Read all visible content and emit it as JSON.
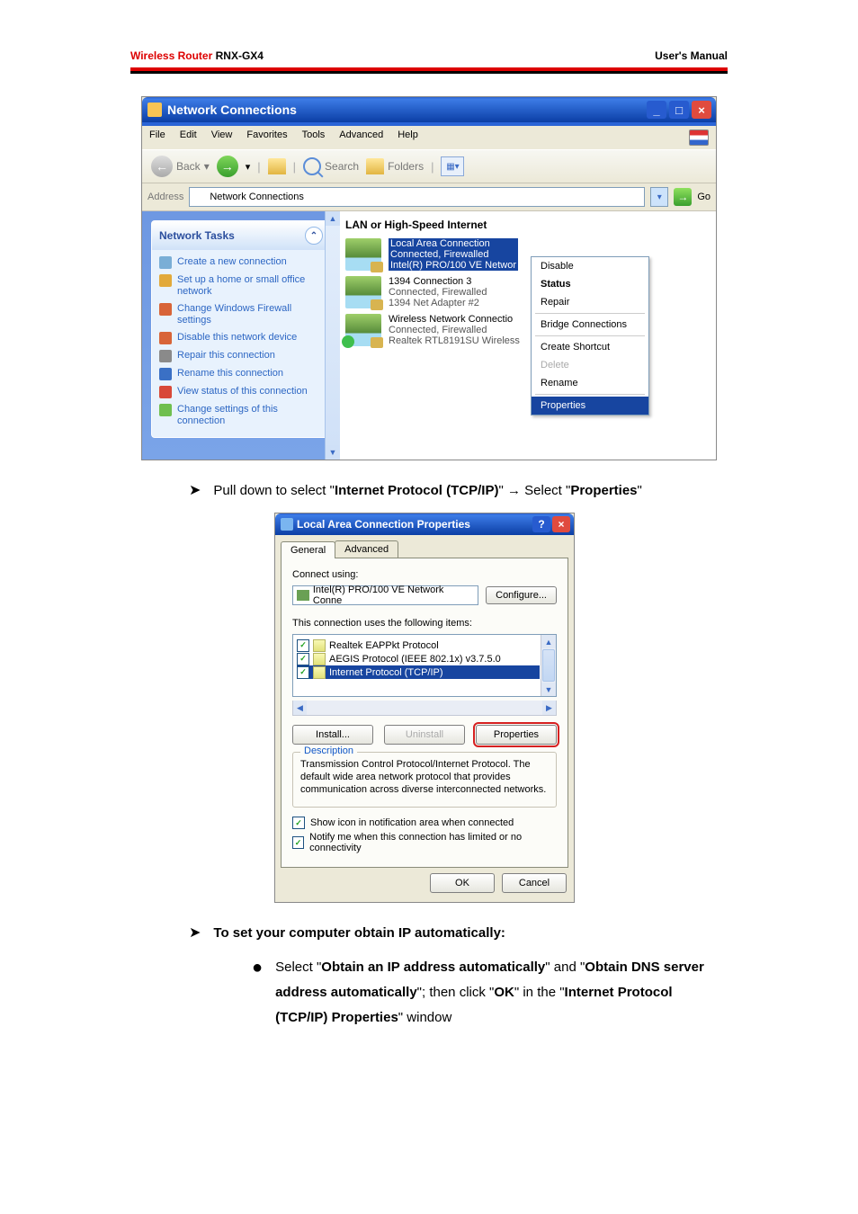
{
  "header": {
    "brand_red": "Wireless Router",
    "model": "RNX-GX4",
    "manual": "User's Manual"
  },
  "win1": {
    "title": "Network Connections",
    "menus": [
      "File",
      "Edit",
      "View",
      "Favorites",
      "Tools",
      "Advanced",
      "Help"
    ],
    "toolbar": {
      "back": "Back",
      "search": "Search",
      "folders": "Folders"
    },
    "address": {
      "label": "Address",
      "value": "Network Connections",
      "go": "Go"
    },
    "tasks_title": "Network Tasks",
    "tasks": [
      "Create a new connection",
      "Set up a home or small office network",
      "Change Windows Firewall settings",
      "Disable this network device",
      "Repair this connection",
      "Rename this connection",
      "View status of this connection",
      "Change settings of this connection"
    ],
    "section": "LAN or High-Speed Internet",
    "conns": [
      {
        "name": "Local Area Connection",
        "s1": "Connected, Firewalled",
        "s2": "Intel(R) PRO/100 VE Networ"
      },
      {
        "name": "1394 Connection 3",
        "s1": "Connected, Firewalled",
        "s2": "1394 Net Adapter #2"
      },
      {
        "name": "Wireless Network Connectio",
        "s1": "Connected, Firewalled",
        "s2": "Realtek RTL8191SU Wireless"
      }
    ],
    "ctx": {
      "disable": "Disable",
      "status": "Status",
      "repair": "Repair",
      "bridge": "Bridge Connections",
      "shortcut": "Create Shortcut",
      "delete": "Delete",
      "rename": "Rename",
      "properties": "Properties"
    }
  },
  "instr1": {
    "pre": "Pull down to select \"",
    "b1": "Internet Protocol (TCP/IP)",
    "mid": "\"  →  Select \"",
    "b2": "Properties",
    "post": "\""
  },
  "win2": {
    "title": "Local Area Connection Properties",
    "tab_general": "General",
    "tab_advanced": "Advanced",
    "connect_using": "Connect using:",
    "adapter": "Intel(R) PRO/100 VE Network Conne",
    "configure": "Configure...",
    "uses": "This connection uses the following items:",
    "items": [
      "Realtek EAPPkt Protocol",
      "AEGIS Protocol (IEEE 802.1x) v3.7.5.0",
      "Internet Protocol (TCP/IP)"
    ],
    "install": "Install...",
    "uninstall": "Uninstall",
    "properties": "Properties",
    "desc_title": "Description",
    "desc": "Transmission Control Protocol/Internet Protocol. The default wide area network protocol that provides communication across diverse interconnected networks.",
    "chk1": "Show icon in notification area when connected",
    "chk2": "Notify me when this connection has limited or no connectivity",
    "ok": "OK",
    "cancel": "Cancel"
  },
  "instr2": {
    "pre": "To set your computer obtain IP automatically:"
  },
  "instr3": {
    "a": "Select \"",
    "b1": "Obtain an IP address automatically",
    "b": "\" and \"",
    "b2": "Obtain DNS server address automatically",
    "c": "\"; then click \"",
    "b3": "OK",
    "d": "\" in the \"",
    "b4": "Internet Protocol (TCP/IP) Properties",
    "e": "\" window"
  }
}
